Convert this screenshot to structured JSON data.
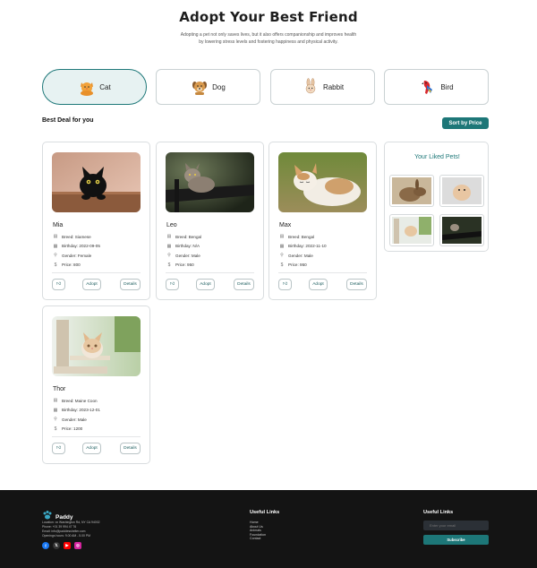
{
  "hero": {
    "title": "Adopt Your Best Friend",
    "subtitle": "Adopting a pet not only saves lives, but it also offers companionship and improves health by lowering stress levels and fostering happiness and physical activity."
  },
  "categories": [
    {
      "label": "Cat",
      "icon": "cat-icon",
      "active": true
    },
    {
      "label": "Dog",
      "icon": "dog-icon",
      "active": false
    },
    {
      "label": "Rabbit",
      "icon": "rabbit-icon",
      "active": false
    },
    {
      "label": "Bird",
      "icon": "bird-icon",
      "active": false
    }
  ],
  "section": {
    "title": "Best Deal for you",
    "sort_label": "Sort by Price"
  },
  "pets": [
    {
      "name": "Mia",
      "breed": "Breed:  Siamese",
      "birthday": "Birthday:  2022-09-05",
      "gender": "Gender:  Female",
      "price": "Price:  800"
    },
    {
      "name": "Leo",
      "breed": "Breed:  Bengal",
      "birthday": "Birthday:  N/A",
      "gender": "Gender:  Male",
      "price": "Price:  950"
    },
    {
      "name": "Max",
      "breed": "Breed:  Bengal",
      "birthday": "Birthday:  2022-11-10",
      "gender": "Gender:  Male",
      "price": "Price:  950"
    },
    {
      "name": "Thor",
      "breed": "Breed:  Maine Coon",
      "birthday": "Birthday:  2023-12-01",
      "gender": "Gender:  Male",
      "price": "Price:  1200"
    }
  ],
  "buttons": {
    "adopt": "Adopt",
    "details": "Details"
  },
  "liked": {
    "title": "Your Liked Pets!"
  },
  "footer": {
    "brand": "Paddy",
    "location": "Location: xx Washington Rd, NY CA 94002",
    "phone": "Phone: +01 39 994 47 76",
    "email": "Email: info@paddiesshelter.com",
    "hours": "Openings hours: 9.00 AM - 5.00 PM",
    "links_title": "Useful Links",
    "links": [
      "Home",
      "About Us",
      "Animals",
      "Foundation",
      "Contact"
    ],
    "newsletter_title": "Useful Links",
    "email_placeholder": "Enter your email",
    "subscribe": "Subscribe"
  },
  "colors": {
    "accent": "#1d7778",
    "footer_bg": "#141414",
    "active_tab_bg": "#e7f2f2"
  }
}
